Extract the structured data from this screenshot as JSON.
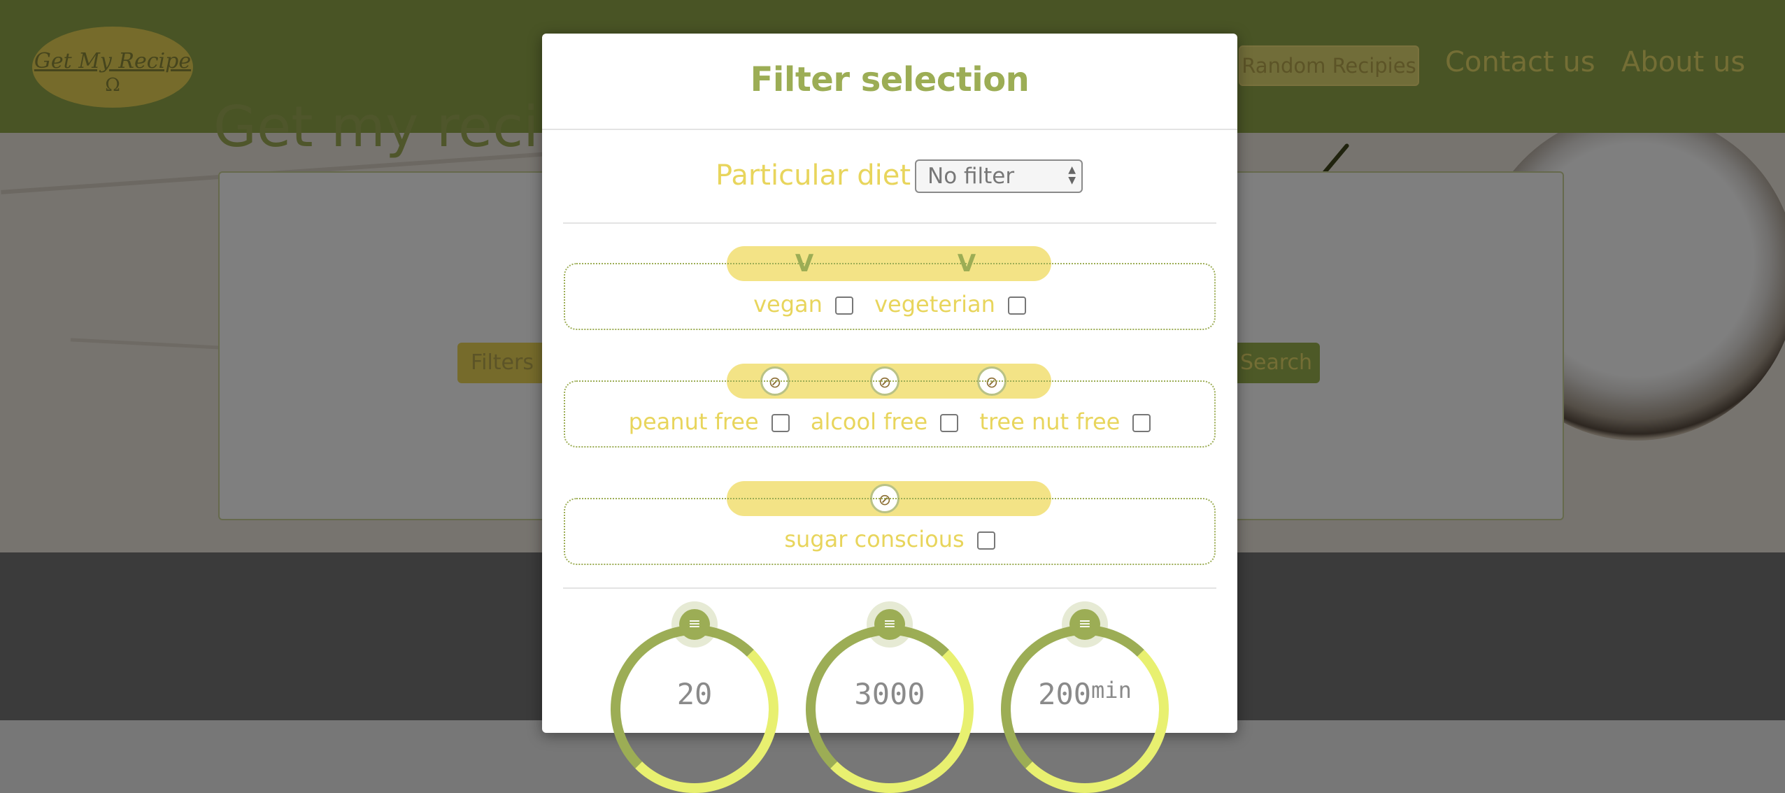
{
  "navbar": {
    "logo_text": "Get My Recipe",
    "logo_symbol": "Ω",
    "random_button": "Random Recipies",
    "contact_link": "Contact us",
    "about_link": "About us"
  },
  "hero": {
    "title": "Get my recipe",
    "filters_button": "Filters",
    "search_button": "Search"
  },
  "modal": {
    "title": "Filter selection",
    "diet_label": "Particular diet",
    "diet_select_value": "No filter",
    "groups": [
      {
        "icons": [
          "vegan-icon",
          "vegetarian-icon"
        ],
        "options": [
          "vegan",
          "vegeterian"
        ]
      },
      {
        "icons": [
          "peanut-free-icon",
          "alcohol-free-icon",
          "tree-nut-free-icon"
        ],
        "options": [
          "peanut free",
          "alcool free",
          "tree nut free"
        ]
      },
      {
        "icons": [
          "sugar-conscious-icon"
        ],
        "options": [
          "sugar conscious"
        ]
      }
    ],
    "dials": [
      {
        "value": "20",
        "unit": ""
      },
      {
        "value": "3000",
        "unit": ""
      },
      {
        "value": "200",
        "unit": "min"
      }
    ]
  },
  "colors": {
    "navbar": "#93a84a",
    "accent_green": "#9cad55",
    "accent_yellow": "#e8d55c",
    "pill_yellow": "#f3e386"
  }
}
